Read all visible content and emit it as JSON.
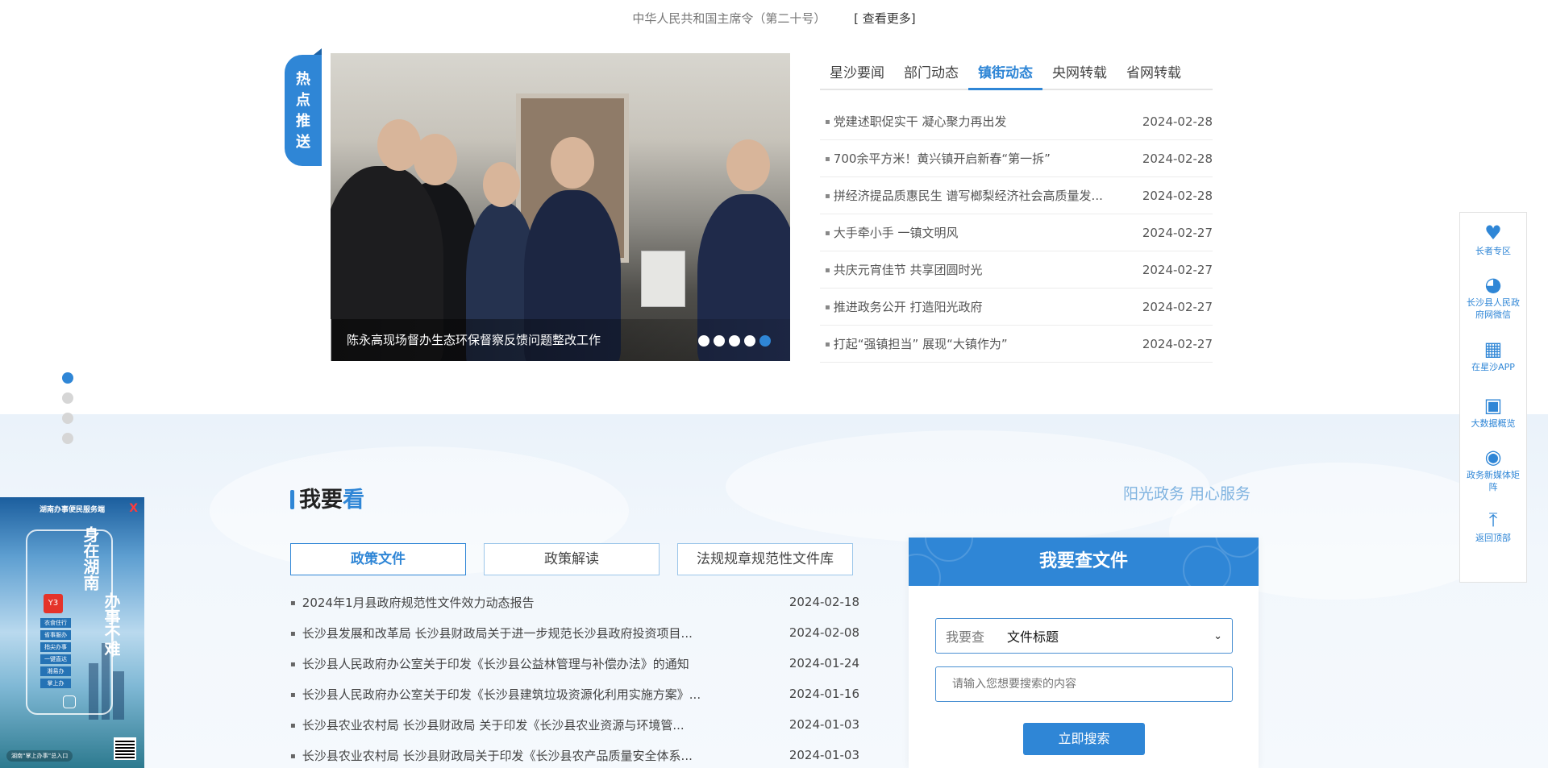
{
  "notice": {
    "text": "中华人民共和国主席令（第二十号）",
    "more": "[ 查看更多]"
  },
  "hot_badge": [
    "热",
    "点",
    "推",
    "送"
  ],
  "slider": {
    "caption": "陈永高现场督办生态环保督察反馈问题整改工作",
    "dot_count": 5,
    "active_dot": 5
  },
  "news_tabs": [
    "星沙要闻",
    "部门动态",
    "镇街动态",
    "央网转载",
    "省网转载"
  ],
  "news_active_tab": 2,
  "news": [
    {
      "title": "党建述职促实干 凝心聚力再出发",
      "date": "2024-02-28"
    },
    {
      "title": "700余平方米！黄兴镇开启新春“第一拆”",
      "date": "2024-02-28"
    },
    {
      "title": "拼经济提品质惠民生 谱写榔梨经济社会高质量发...",
      "date": "2024-02-28"
    },
    {
      "title": "大手牵小手 一镇文明风",
      "date": "2024-02-27"
    },
    {
      "title": "共庆元宵佳节 共享团圆时光",
      "date": "2024-02-27"
    },
    {
      "title": "推进政务公开 打造阳光政府",
      "date": "2024-02-27"
    },
    {
      "title": "打起“强镇担当” 展现“大镇作为”",
      "date": "2024-02-27"
    }
  ],
  "section_dots": 4,
  "want": {
    "title_a": "我要",
    "title_b": "看",
    "slogan": "阳光政务 用心服务"
  },
  "doc_tabs": [
    "政策文件",
    "政策解读",
    "法规规章规范性文件库"
  ],
  "doc_active_tab": 0,
  "docs": [
    {
      "title": "2024年1月县政府规范性文件效力动态报告",
      "date": "2024-02-18"
    },
    {
      "title": "长沙县发展和改革局 长沙县财政局关于进一步规范长沙县政府投资项目...",
      "date": "2024-02-08"
    },
    {
      "title": "长沙县人民政府办公室关于印发《长沙县公益林管理与补偿办法》的通知",
      "date": "2024-01-24"
    },
    {
      "title": "长沙县人民政府办公室关于印发《长沙县建筑垃圾资源化利用实施方案》...",
      "date": "2024-01-16"
    },
    {
      "title": "长沙县农业农村局 长沙县财政局 关于印发《长沙县农业资源与环境管...",
      "date": "2024-01-03"
    },
    {
      "title": "长沙县农业农村局 长沙县财政局关于印发《长沙县农产品质量安全体系...",
      "date": "2024-01-03"
    }
  ],
  "search": {
    "title": "我要查文件",
    "select_label": "我要查",
    "select_value": "文件标题",
    "placeholder": "请输入您想要搜索的内容",
    "button": "立即搜索"
  },
  "ad": {
    "top": "湖南办事便民服务端",
    "close": "X",
    "text1": "身在湖南",
    "text2": "办事不难",
    "logo": "Y3",
    "menu": [
      "衣食住行",
      "省事服办",
      "指尖办事",
      "一键直达",
      "湘易办",
      "掌上办"
    ],
    "bottom": "湖南“掌上办事”总入口"
  },
  "float_bar": [
    {
      "icon": "elder-zone-icon",
      "glyph": "♥",
      "label": "长者专区"
    },
    {
      "icon": "wechat-icon",
      "glyph": "◕",
      "label": "长沙县人民政府网微信"
    },
    {
      "icon": "app-icon",
      "glyph": "▦",
      "label": "在星沙APP"
    },
    {
      "icon": "bigdata-icon",
      "glyph": "▣",
      "label": "大数据概览"
    },
    {
      "icon": "media-icon",
      "glyph": "◉",
      "label": "政务新媒体矩阵"
    },
    {
      "icon": "back-top-icon",
      "glyph": "⤒",
      "label": "返回顶部"
    }
  ],
  "colors": {
    "accent": "#2f86d6",
    "slogan": "#7fb3e0"
  }
}
